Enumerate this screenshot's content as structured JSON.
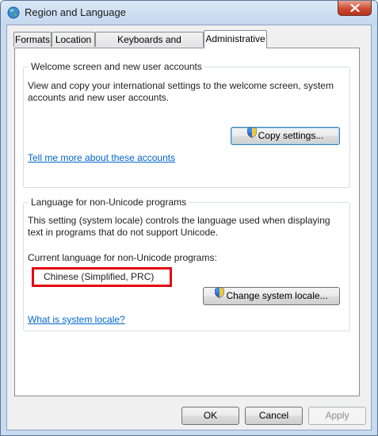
{
  "window": {
    "title": "Region and Language"
  },
  "tabs": [
    {
      "label": "Formats"
    },
    {
      "label": "Location"
    },
    {
      "label": "Keyboards and Languages"
    },
    {
      "label": "Administrative"
    }
  ],
  "welcome": {
    "group_title": "Welcome screen and new user accounts",
    "description_line1": "View and copy your international settings to the welcome screen, system",
    "description_line2": "accounts and new user accounts.",
    "copy_button": "Copy settings...",
    "link": "Tell me more about these accounts"
  },
  "non_unicode": {
    "group_title": "Language for non-Unicode programs",
    "description_line1": "This setting (system locale) controls the language used when displaying",
    "description_line2": "text in programs that do not support Unicode.",
    "current_label": "Current language for non-Unicode programs:",
    "current_value": "Chinese (Simplified, PRC)",
    "change_button": "Change system locale...",
    "link": "What is system locale?"
  },
  "footer": {
    "ok": "OK",
    "cancel": "Cancel",
    "apply": "Apply"
  },
  "colors": {
    "highlight_border": "#e30613",
    "link": "#0066cc"
  },
  "icons": [
    "globe-icon",
    "close-icon",
    "shield-icon"
  ]
}
